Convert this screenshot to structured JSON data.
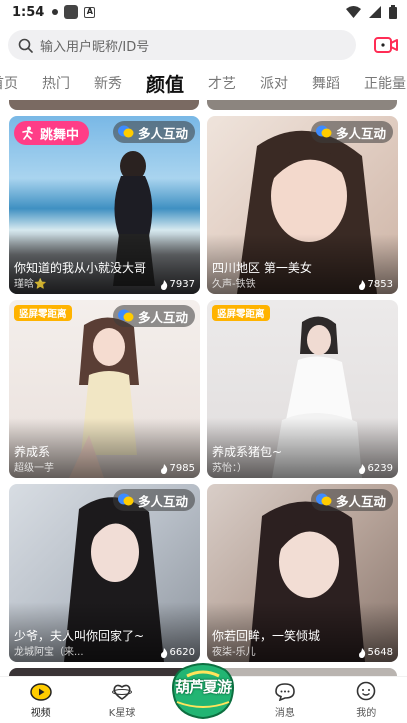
{
  "status_bar": {
    "time": "1:54"
  },
  "search": {
    "placeholder": "输入用户昵称/ID号"
  },
  "tabs": [
    {
      "label": "首页",
      "active": false
    },
    {
      "label": "热门",
      "active": false
    },
    {
      "label": "新秀",
      "active": false
    },
    {
      "label": "颜值",
      "active": true
    },
    {
      "label": "才艺",
      "active": false
    },
    {
      "label": "派对",
      "active": false
    },
    {
      "label": "舞蹈",
      "active": false
    },
    {
      "label": "正能量",
      "active": false
    }
  ],
  "badges": {
    "multi": "多人互动",
    "dance": "跳舞中",
    "vertical": "竖屏零距离"
  },
  "cards": [
    {
      "title": "你知道的我从小就没大哥",
      "host": "瑾晗⭐",
      "count": "7937",
      "badge": "dance",
      "multi": true
    },
    {
      "title": "四川地区 第一美女",
      "host": "久声-铁铁",
      "count": "7853",
      "badge": "",
      "multi": true
    },
    {
      "title": "养成系",
      "host": "超级一芋",
      "count": "7985",
      "badge": "vertical",
      "multi": true
    },
    {
      "title": "养成系猪包~",
      "host": "苏怡：）",
      "count": "6239",
      "badge": "vertical",
      "multi": false
    },
    {
      "title": "少爷，夫人叫你回家了~",
      "host": "龙城阿宝（来...",
      "count": "6620",
      "badge": "",
      "multi": true
    },
    {
      "title": "你若回眸，一笑倾城",
      "host": "夜柒-乐儿",
      "count": "5648",
      "badge": "",
      "multi": true
    }
  ],
  "nav": [
    {
      "label": "视频",
      "icon": "video-icon",
      "active": true
    },
    {
      "label": "K星球",
      "icon": "heart-planet-icon",
      "active": false
    },
    {
      "label": "",
      "icon": "center-logo",
      "active": false
    },
    {
      "label": "消息",
      "icon": "message-icon",
      "active": false
    },
    {
      "label": "我的",
      "icon": "profile-icon",
      "active": false
    }
  ],
  "center_badge_text": "葫芦夏游",
  "colors": {
    "accent": "#ffcc00",
    "dance_badge": "#ff3d87",
    "vertical_badge": "#ffb300"
  }
}
